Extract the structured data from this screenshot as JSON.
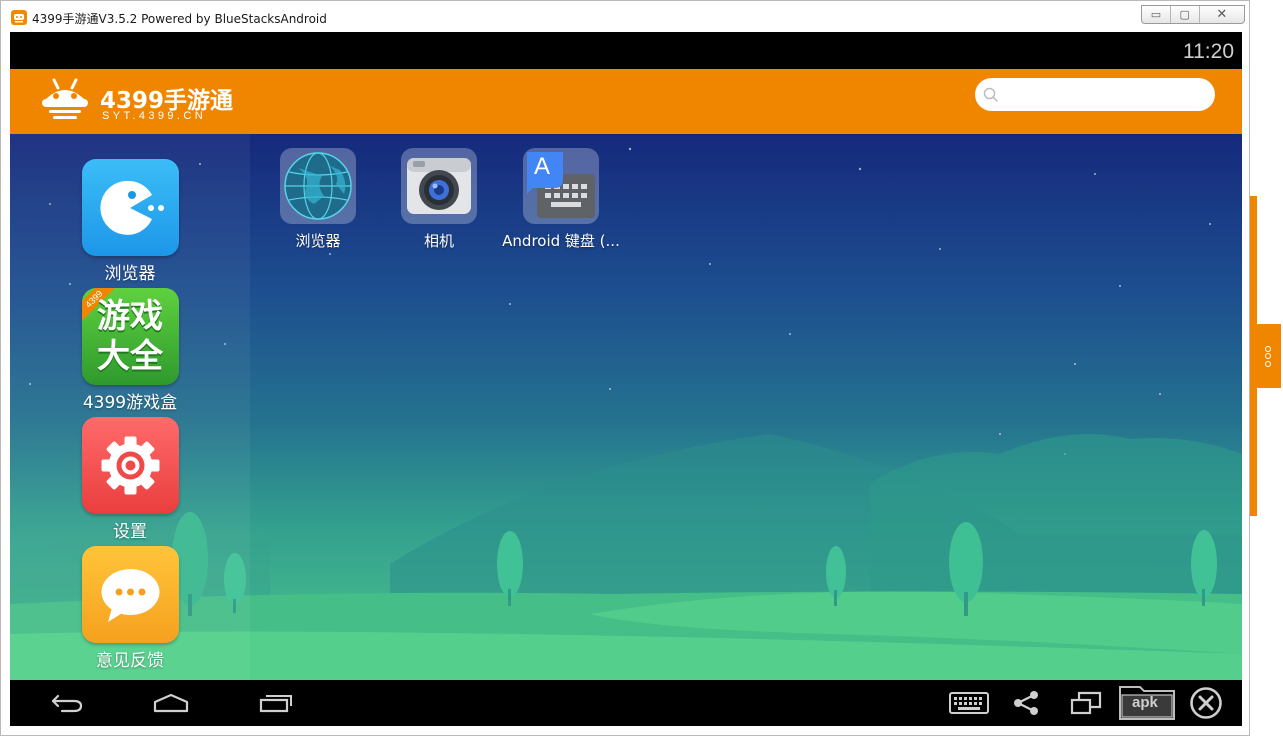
{
  "window": {
    "title": "4399手游通V3.5.2 Powered by BlueStacksAndroid",
    "controls": {
      "minimize": "▭",
      "maximize": "▢",
      "close": "✕"
    }
  },
  "status_bar": {
    "time": "11:20"
  },
  "header": {
    "logo_main": "4399手游通",
    "logo_sub": "SYT.4399.CN",
    "search": {
      "value": "",
      "placeholder": "",
      "icon": "search-icon"
    },
    "color": "#f08500"
  },
  "dock": {
    "items": [
      {
        "label": "浏览器",
        "icon": "pacman-browser-icon",
        "color": "#27a8f0"
      },
      {
        "label": "4399游戏盒",
        "icon": "game-box-icon",
        "tile_text_1": "游戏",
        "tile_text_2": "大全",
        "ribbon": "4399",
        "color": "#3ca83a"
      },
      {
        "label": "设置",
        "icon": "gear-icon",
        "color": "#f04e4e"
      },
      {
        "label": "意见反馈",
        "icon": "chat-bubble-icon",
        "color": "#f7a823"
      }
    ]
  },
  "desktop": {
    "apps": [
      {
        "label": "浏览器",
        "icon": "globe-icon"
      },
      {
        "label": "相机",
        "icon": "camera-icon"
      },
      {
        "label": "Android 键盘 (...",
        "icon": "keyboard-app-icon",
        "tile_letter": "A"
      }
    ]
  },
  "nav_bar": {
    "buttons": [
      "back-icon",
      "home-icon",
      "recent-apps-icon"
    ],
    "tools": [
      "keyboard-icon",
      "share-icon",
      "multi-window-icon",
      "apk-install-icon",
      "close-circle-icon"
    ],
    "apk_label": "apk"
  },
  "side_panel": {
    "icon": "more-dots-icon"
  }
}
